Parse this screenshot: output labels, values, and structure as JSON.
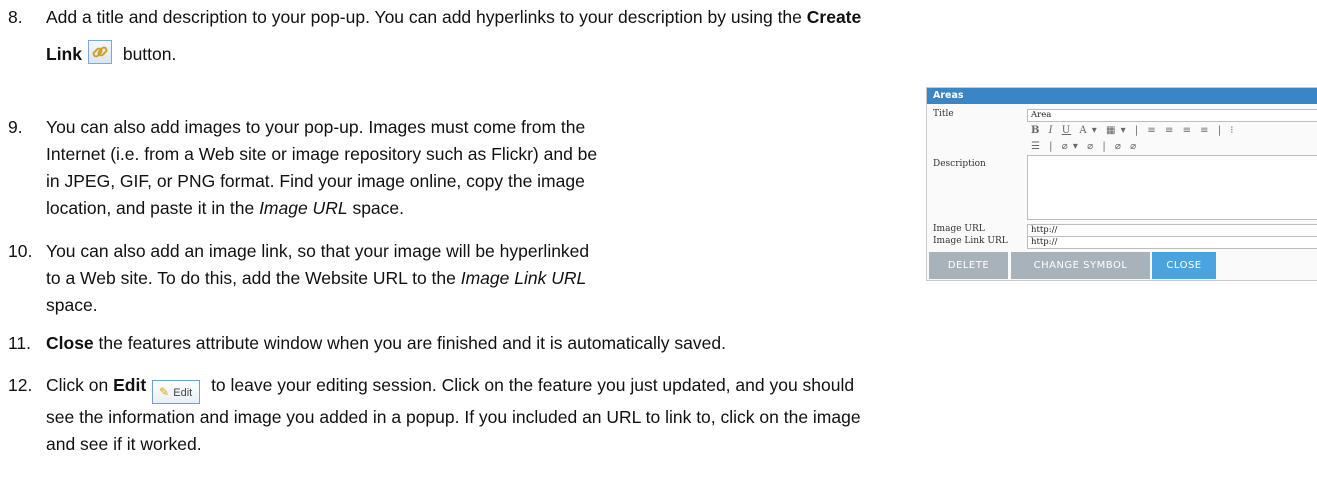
{
  "steps": [
    {
      "num": "8.",
      "line1_before": "Add a title and description to your pop-up. You can add hyperlinks to your description by using the ",
      "line1_bold": "Create",
      "line2_bold": "Link",
      "line2_after": " button."
    },
    {
      "num": "9.",
      "lines": [
        "You can also add images to your pop-up. Images must come from the",
        "Internet (i.e. from a Web site or image repository such as Flickr) and be",
        "in JPEG, GIF, or PNG format. Find your image online, copy the image"
      ],
      "last_before": "location, and paste it in the ",
      "last_italic": "Image URL",
      "last_after": " space."
    },
    {
      "num": "10.",
      "lines": [
        "You can also add an image link, so that your image will be hyperlinked"
      ],
      "line2_before": "to a Web site. To do this, add the Website URL to the ",
      "line2_italic": "Image Link URL",
      "last": "space."
    },
    {
      "num": "11.",
      "bold": "Close",
      "after": " the features attribute window when you are finished and it is automatically saved."
    },
    {
      "num": "12.",
      "before": "Click on ",
      "bold": "Edit",
      "after": " to leave your editing session. Click on the feature you just updated, and you should",
      "line2": "see the information and image you added in a popup. If you included an URL to link to, click on the image",
      "line3": "and see if it worked."
    }
  ],
  "edit_button_label": "Edit",
  "dialog": {
    "title": "Areas",
    "title_label": "Title",
    "title_value": "Area",
    "description_label": "Description",
    "toolbar_row1": [
      "B",
      "I",
      "U",
      "A ▾",
      "▦ ▾",
      "|",
      "≡",
      "≡",
      "≡",
      "≡",
      "|",
      "⁝"
    ],
    "toolbar_row2": [
      "☰",
      "|",
      "⌀ ▾",
      "⌀",
      "|",
      "⌀",
      "⌀"
    ],
    "image_url_label": "Image URL",
    "image_url_value": "http://",
    "image_link_url_label": "Image Link URL",
    "image_link_url_value": "http://",
    "buttons": {
      "delete": "DELETE",
      "change_symbol": "CHANGE SYMBOL",
      "close": "CLOSE"
    }
  },
  "colors": {
    "dialog_header": "#3a85c6",
    "button_gray": "#a8b2bb",
    "button_blue": "#4ba4e0"
  }
}
